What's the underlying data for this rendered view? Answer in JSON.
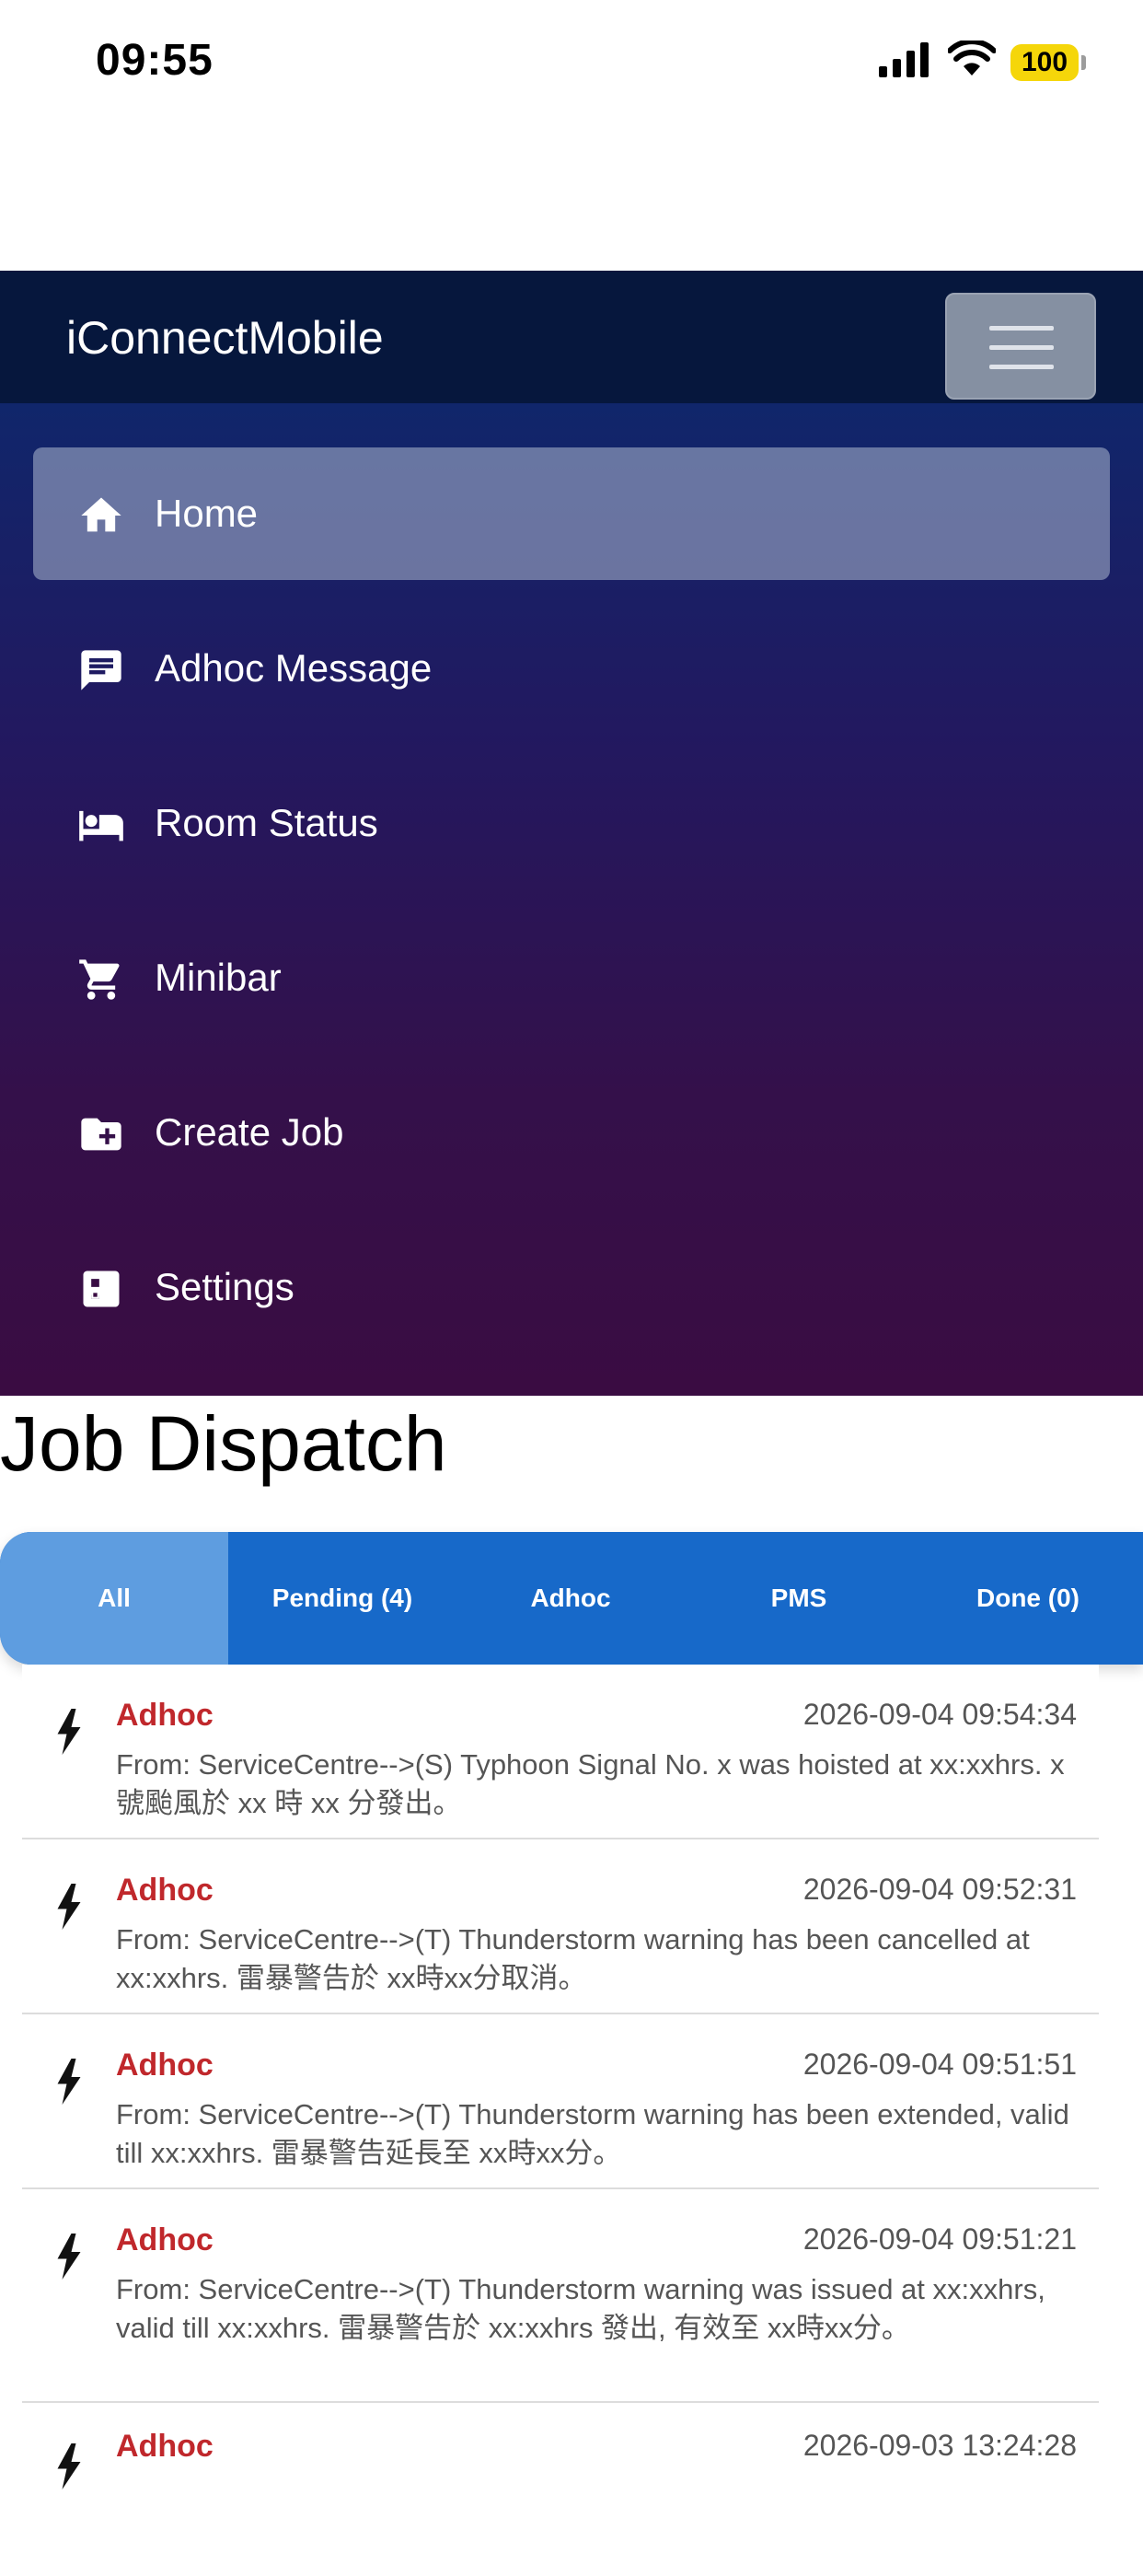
{
  "status_bar": {
    "time": "09:55",
    "battery": "100"
  },
  "navbar": {
    "brand": "iConnectMobile"
  },
  "menu": [
    {
      "label": "Home",
      "icon": "home-icon",
      "active": true
    },
    {
      "label": "Adhoc Message",
      "icon": "message-icon",
      "active": false
    },
    {
      "label": "Room Status",
      "icon": "bed-icon",
      "active": false
    },
    {
      "label": "Minibar",
      "icon": "cart-icon",
      "active": false
    },
    {
      "label": "Create Job",
      "icon": "folder-plus-icon",
      "active": false
    },
    {
      "label": "Settings",
      "icon": "settings-list-icon",
      "active": false
    }
  ],
  "page": {
    "title": "Job Dispatch"
  },
  "tabs": [
    {
      "label": "All",
      "active": true
    },
    {
      "label": "Pending (4)",
      "active": false
    },
    {
      "label": "Adhoc",
      "active": false
    },
    {
      "label": "PMS",
      "active": false
    },
    {
      "label": "Done (0)",
      "active": false
    }
  ],
  "jobs": [
    {
      "type": "Adhoc",
      "timestamp": "2026-09-04 09:54:34",
      "message": "From: ServiceCentre-->(S) Typhoon Signal No. x was hoisted at xx:xxhrs. x 號颱風於 xx 時 xx 分發出。"
    },
    {
      "type": "Adhoc",
      "timestamp": "2026-09-04 09:52:31",
      "message": "From: ServiceCentre-->(T) Thunderstorm warning has been cancelled at xx:xxhrs. 雷暴警告於 xx時xx分取消。"
    },
    {
      "type": "Adhoc",
      "timestamp": "2026-09-04 09:51:51",
      "message": "From: ServiceCentre-->(T) Thunderstorm warning has been extended, valid till xx:xxhrs. 雷暴警告延長至 xx時xx分。"
    },
    {
      "type": "Adhoc",
      "timestamp": "2026-09-04 09:51:21",
      "message": "From: ServiceCentre-->(T) Thunderstorm warning was issued at xx:xxhrs, valid till xx:xxhrs. 雷暴警告於 xx:xxhrs 發出, 有效至 xx時xx分。"
    },
    {
      "type": "Adhoc",
      "timestamp": "2026-09-03 13:24:28",
      "message": ""
    }
  ]
}
